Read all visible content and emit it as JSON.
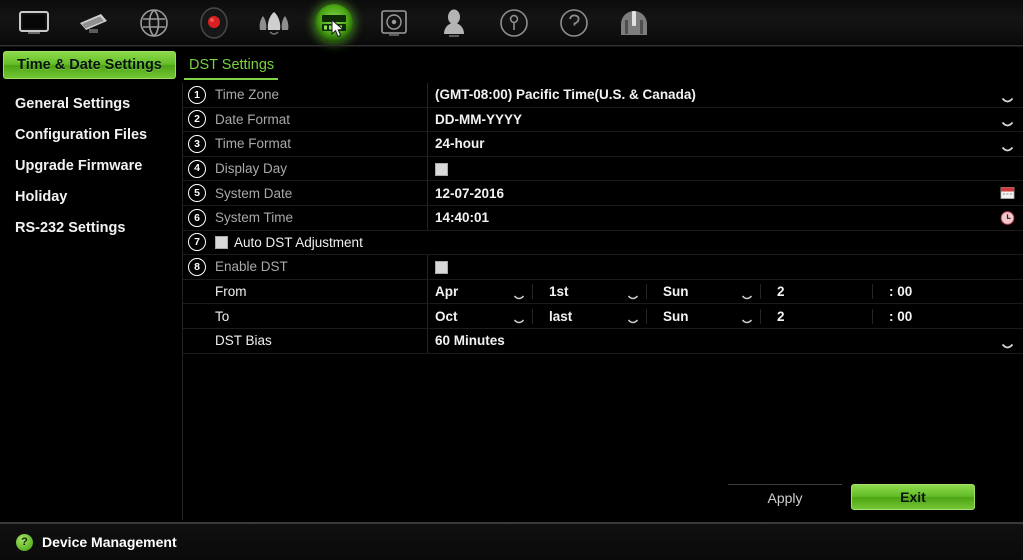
{
  "toolbar": {
    "items": [
      {
        "icon": "monitor-icon",
        "name": "display",
        "active": false
      },
      {
        "icon": "camera-icon",
        "name": "camera",
        "active": false
      },
      {
        "icon": "network-icon",
        "name": "network",
        "active": false
      },
      {
        "icon": "record-icon",
        "name": "record",
        "active": false
      },
      {
        "icon": "alarm-icon",
        "name": "alarm",
        "active": false
      },
      {
        "icon": "settings-icon",
        "name": "device-settings",
        "active": true
      },
      {
        "icon": "hard-drive-icon",
        "name": "storage",
        "active": false
      },
      {
        "icon": "user-icon",
        "name": "user",
        "active": false
      },
      {
        "icon": "info-icon",
        "name": "system-info",
        "active": false
      },
      {
        "icon": "help-icon",
        "name": "help",
        "active": false
      },
      {
        "icon": "shutdown-icon",
        "name": "shutdown",
        "active": false
      }
    ]
  },
  "tabs": {
    "active_label": "Time & Date Settings",
    "inactive_label": "DST Settings"
  },
  "sidebar": {
    "items": [
      {
        "label": "General Settings"
      },
      {
        "label": "Configuration Files"
      },
      {
        "label": "Upgrade Firmware"
      },
      {
        "label": "Holiday"
      },
      {
        "label": "RS-232 Settings"
      }
    ]
  },
  "form": {
    "rows": [
      {
        "num": "1",
        "label": "Time Zone",
        "value": "(GMT-08:00) Pacific Time(U.S. & Canada)",
        "control": "dropdown"
      },
      {
        "num": "2",
        "label": "Date Format",
        "value": "DD-MM-YYYY",
        "control": "dropdown"
      },
      {
        "num": "3",
        "label": "Time Format",
        "value": "24-hour",
        "control": "dropdown"
      },
      {
        "num": "4",
        "label": "Display Day",
        "value": "",
        "control": "checkbox",
        "checked": true
      },
      {
        "num": "5",
        "label": "System Date",
        "value": "12-07-2016",
        "control": "calendar",
        "icon": "calendar-icon"
      },
      {
        "num": "6",
        "label": "System Time",
        "value": "14:40:01",
        "control": "clock",
        "icon": "clock-icon"
      }
    ],
    "auto_dst": {
      "num": "7",
      "label": "Auto DST Adjustment",
      "checked": true
    },
    "enable_dst": {
      "num": "8",
      "label": "Enable DST",
      "checked": true
    },
    "dst_from": {
      "label": "From",
      "month": "Apr",
      "week": "1st",
      "day": "Sun",
      "hour": "2",
      "minute": ": 00"
    },
    "dst_to": {
      "label": "To",
      "month": "Oct",
      "week": "last",
      "day": "Sun",
      "hour": "2",
      "minute": ": 00"
    },
    "dst_bias": {
      "label": "DST Bias",
      "value": "60 Minutes",
      "control": "dropdown"
    }
  },
  "buttons": {
    "apply": "Apply",
    "exit": "Exit"
  },
  "statusbar": {
    "help_glyph": "?",
    "title": "Device Management"
  },
  "colors": {
    "accent_green": "#63bd27",
    "tab_text_green": "#77d23c",
    "background": "#000000",
    "label_gray": "#a9a9a9"
  }
}
